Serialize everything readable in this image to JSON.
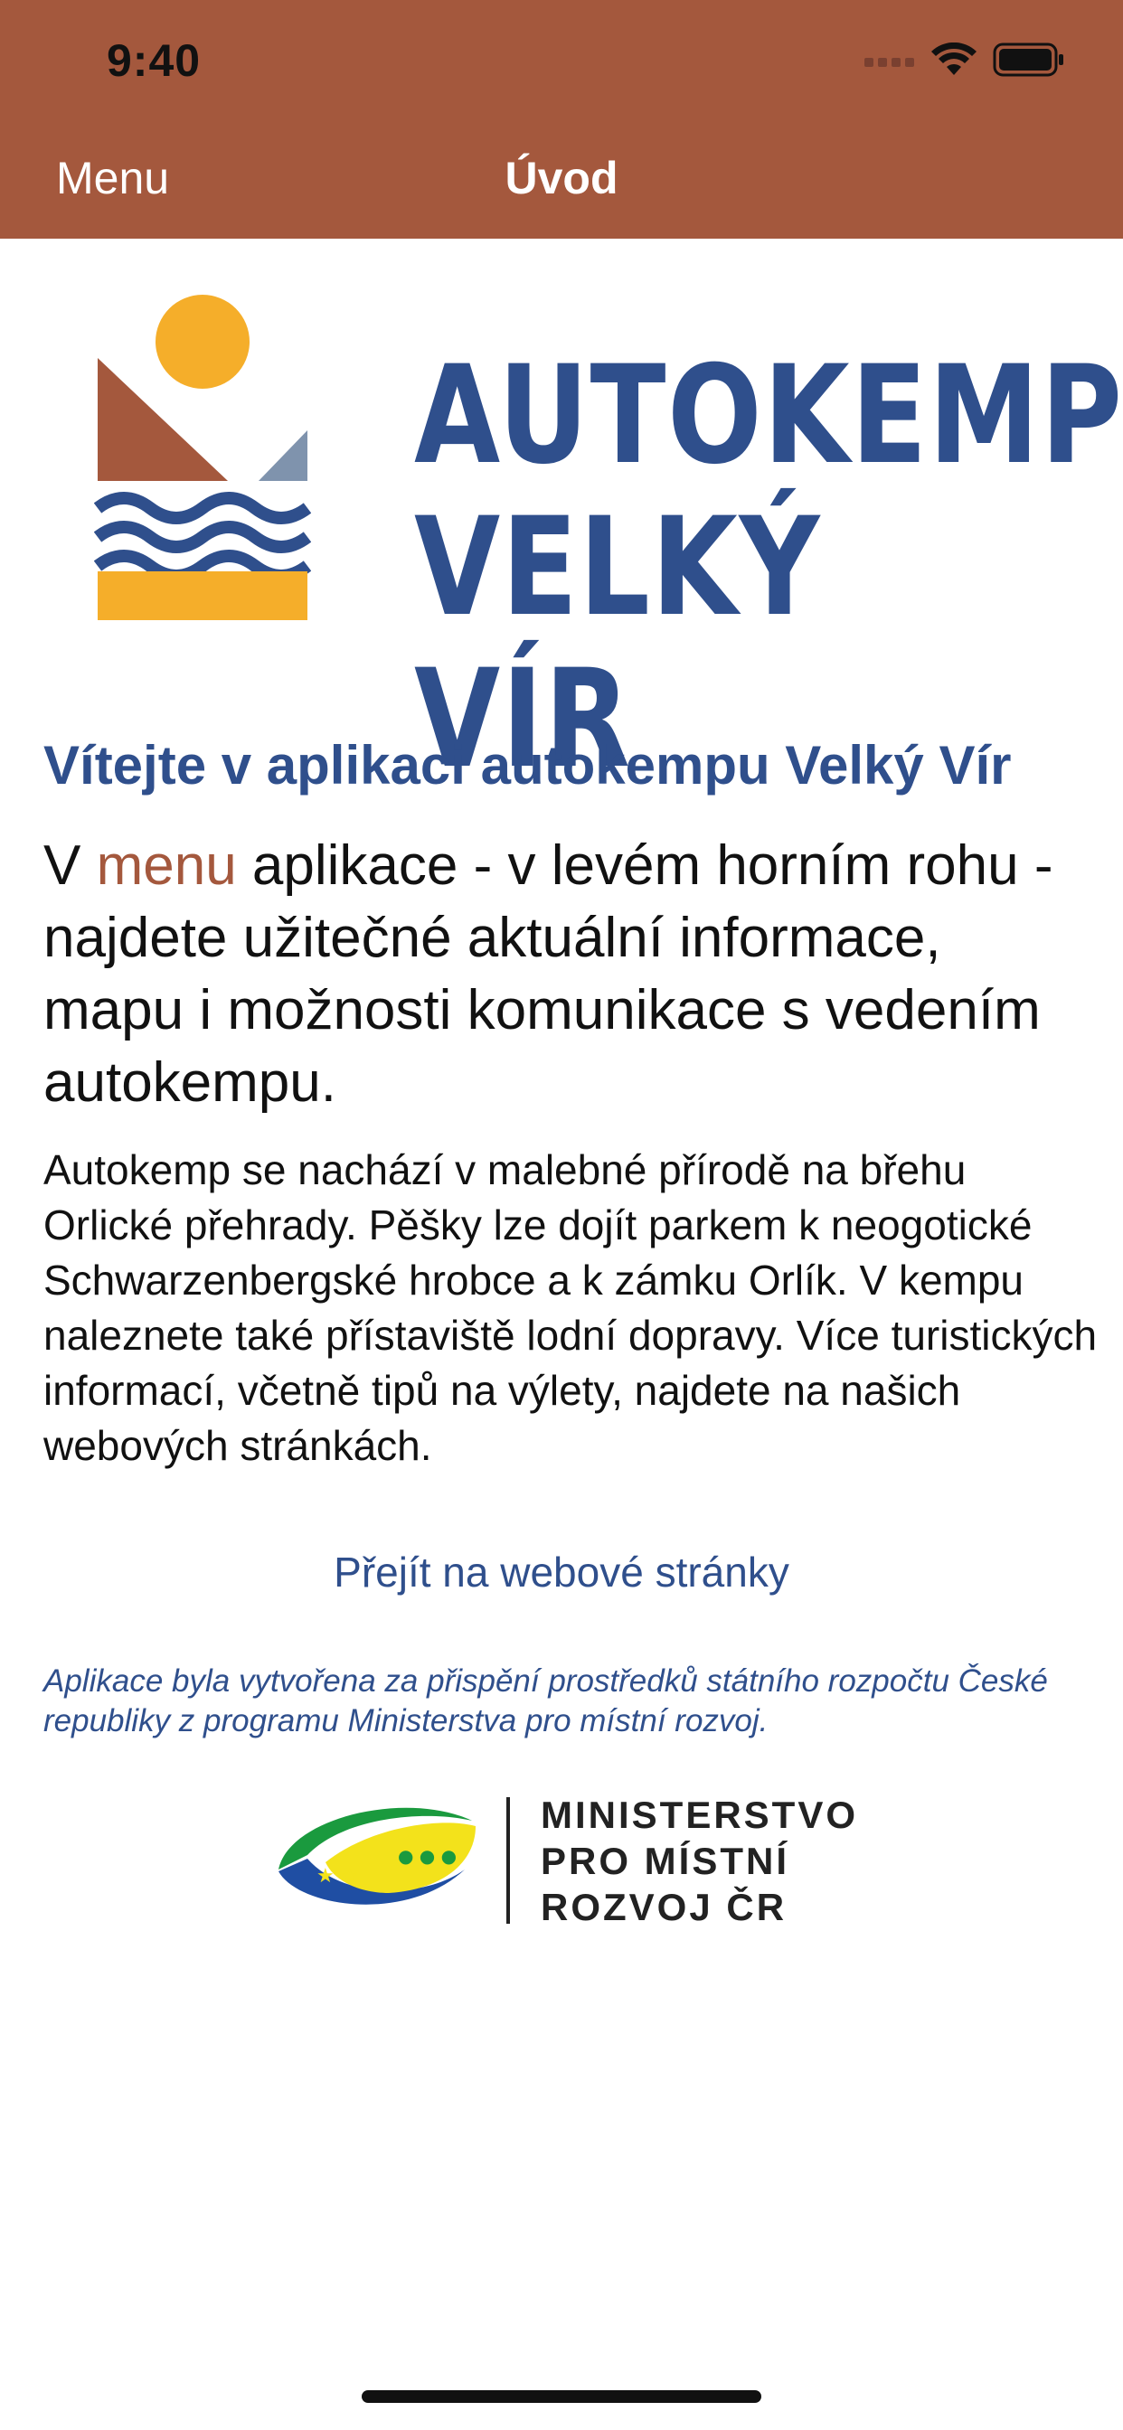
{
  "status_bar": {
    "time": "9:40",
    "icons": [
      "signal-icon",
      "wifi-icon",
      "battery-icon"
    ]
  },
  "nav": {
    "menu_label": "Menu",
    "title": "Úvod"
  },
  "logo": {
    "line1": "AUTOKEMP",
    "line2": "VELKÝ VÍR"
  },
  "content": {
    "welcome": "Vítejte v aplikaci autokempu Velký Vír",
    "lead_prefix": "V ",
    "lead_highlight": "menu",
    "lead_suffix": " aplikace - v levém horním rohu - najdete užitečné aktuální informace, mapu i možnosti komunikace s vedením autokempu.",
    "body": "Autokemp se nachází v malebné přírodě na břehu Orlické přehrady. Pěšky lze dojít parkem k neogotické Schwarzenbergské hrobce a k zámku Orlík. V kempu naleznete také přístaviště lodní dopravy. Více turistických informací, včetně tipů na výlety, najdete na našich webových stránkách.",
    "web_link": "Přejít na webové stránky",
    "note": "Aplikace byla vytvořena za přispění prostředků státního rozpočtu České republiky z programu Ministerstva pro místní rozvoj."
  },
  "ministry": {
    "name": "MINISTERSTVO\nPRO MÍSTNÍ\nROZVOJ ČR"
  },
  "colors": {
    "header": "#a4583d",
    "brand_blue": "#2f4f8c",
    "sun_yellow": "#f5ae2a",
    "hill_brown": "#a4583d",
    "hill_grey": "#7f93ad"
  }
}
